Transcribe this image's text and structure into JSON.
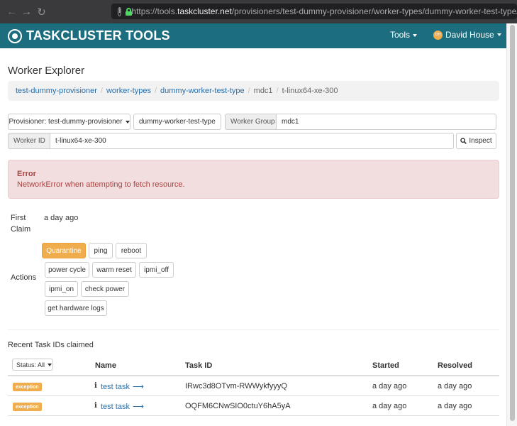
{
  "browser": {
    "url_prefix": "https://tools.",
    "url_domain": "taskcluster.net",
    "url_path": "/provisioners/test-dummy-provisioner/worker-types/dummy-worker-test-type/wor"
  },
  "navbar": {
    "brand": "TASKCLUSTER TOOLS",
    "tools_label": "Tools",
    "user_name": "David House",
    "avatar_text": "DH",
    "color": "#1c6e7f"
  },
  "page": {
    "title": "Worker Explorer"
  },
  "breadcrumb": {
    "items": [
      "test-dummy-provisioner",
      "worker-types",
      "dummy-worker-test-type"
    ],
    "group": "mdc1",
    "current": "t-linux64-xe-300"
  },
  "form": {
    "provisioner_label": "Provisioner: test-dummy-provisioner",
    "worker_type_value": "dummy-worker-test-type",
    "worker_group_label": "Worker Group",
    "worker_group_value": "mdc1",
    "worker_id_label": "Worker ID",
    "worker_id_value": "t-linux64-xe-300",
    "inspect_label": "Inspect"
  },
  "alert": {
    "title": "Error",
    "message": "NetworkError when attempting to fetch resource."
  },
  "worker": {
    "first_claim_label_1": "First",
    "first_claim_label_2": "Claim",
    "first_claim_value": "a day ago",
    "actions_label": "Actions",
    "actions": [
      "Quarantine",
      "ping",
      "reboot",
      "power cycle",
      "warm reset",
      "ipmi_off",
      "ipmi_on",
      "check power",
      "get hardware logs"
    ]
  },
  "recent": {
    "title": "Recent Task IDs claimed",
    "status_filter": "Status: All",
    "headers": {
      "name": "Name",
      "task_id": "Task ID",
      "started": "Started",
      "resolved": "Resolved"
    },
    "rows": [
      {
        "status": "exception",
        "name": "test task",
        "task_id": "IRwc3d8OTvm-RWWykfyyyQ",
        "started": "a day ago",
        "resolved": "a day ago"
      },
      {
        "status": "exception",
        "name": "test task",
        "task_id": "OQFM6CNwSIO0ctuY6hA5yA",
        "started": "a day ago",
        "resolved": "a day ago"
      }
    ]
  }
}
